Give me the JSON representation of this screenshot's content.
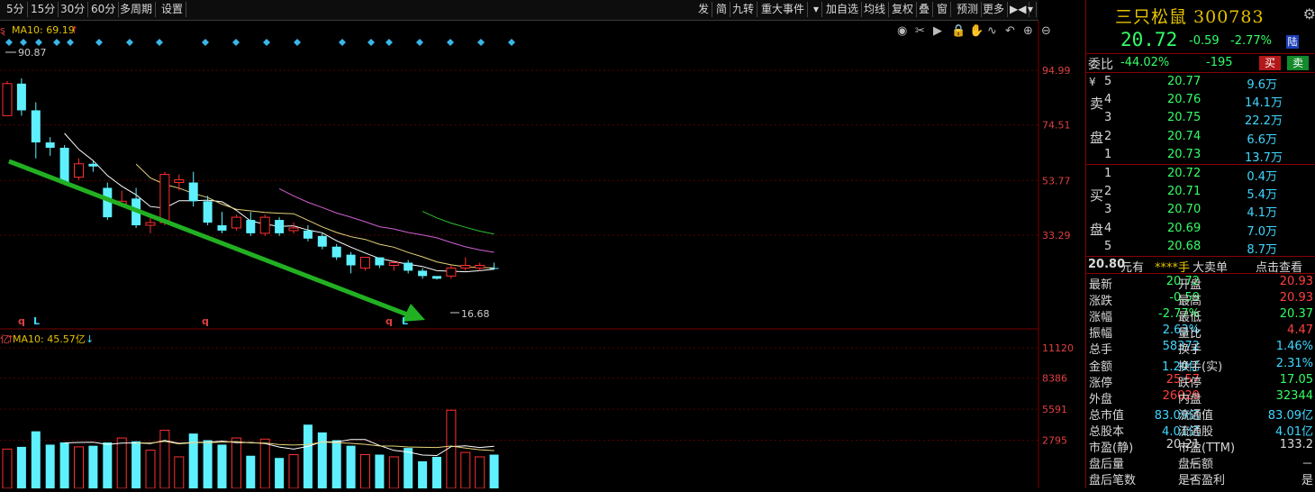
{
  "toolbar": {
    "periods": [
      "5分",
      "15分",
      "30分",
      "60分",
      "多周期",
      "设置"
    ],
    "right_tools": [
      "发",
      "简",
      "九转",
      "重大事件",
      "▾",
      "加自选",
      "均线",
      "复权",
      "叠",
      "窗",
      "预测",
      "更多",
      "▶◀",
      "▾"
    ]
  },
  "main_chart": {
    "ma_label": "MA10: 69.19",
    "marker_left": "ȿ",
    "annotations": {
      "high": "90.87",
      "low": "16.68"
    },
    "price_ticks": [
      "94.99",
      "74.51",
      "53.77",
      "33.29"
    ],
    "bottom_marks": [
      "q",
      "L",
      "q",
      "q",
      "L"
    ],
    "toolbar_icons": [
      "eye-icon",
      "scissors-icon",
      "play-icon",
      "lock-icon",
      "hand-icon",
      "wave-icon",
      "undo-icon",
      "zoom-in-icon",
      "zoom-out-icon"
    ]
  },
  "volume_chart": {
    "unit": "亿",
    "ma_label": "MA10: 45.57亿",
    "ticks": [
      "11120",
      "8386",
      "5591",
      "2795"
    ]
  },
  "chart_data": {
    "type": "candlestick",
    "price_axis": {
      "ticks": [
        94.99,
        74.51,
        53.77,
        33.29
      ]
    },
    "candles": [
      {
        "o": 78,
        "c": 90,
        "h": 91,
        "l": 78
      },
      {
        "o": 90,
        "c": 80,
        "h": 92,
        "l": 78
      },
      {
        "o": 80,
        "c": 68,
        "h": 83,
        "l": 62
      },
      {
        "o": 68,
        "c": 66,
        "h": 70,
        "l": 63
      },
      {
        "o": 66,
        "c": 53,
        "h": 67,
        "l": 52
      },
      {
        "o": 55,
        "c": 60,
        "h": 62,
        "l": 54
      },
      {
        "o": 60,
        "c": 59,
        "h": 61,
        "l": 57
      },
      {
        "o": 51,
        "c": 40,
        "h": 53,
        "l": 39
      },
      {
        "o": 45,
        "c": 46,
        "h": 50,
        "l": 44
      },
      {
        "o": 47,
        "c": 37,
        "h": 51,
        "l": 36
      },
      {
        "o": 37,
        "c": 38,
        "h": 40,
        "l": 34
      },
      {
        "o": 38,
        "c": 56,
        "h": 57,
        "l": 37
      },
      {
        "o": 53,
        "c": 54,
        "h": 56,
        "l": 50
      },
      {
        "o": 53,
        "c": 46,
        "h": 57,
        "l": 44
      },
      {
        "o": 46,
        "c": 38,
        "h": 48,
        "l": 37
      },
      {
        "o": 37,
        "c": 35,
        "h": 42,
        "l": 34
      },
      {
        "o": 36,
        "c": 40,
        "h": 41,
        "l": 35
      },
      {
        "o": 39,
        "c": 34,
        "h": 42,
        "l": 33
      },
      {
        "o": 34,
        "c": 40,
        "h": 41,
        "l": 33
      },
      {
        "o": 39,
        "c": 34,
        "h": 40,
        "l": 33
      },
      {
        "o": 35,
        "c": 36,
        "h": 38,
        "l": 34
      },
      {
        "o": 35,
        "c": 32,
        "h": 37,
        "l": 31
      },
      {
        "o": 33,
        "c": 29,
        "h": 34,
        "l": 28
      },
      {
        "o": 29,
        "c": 25,
        "h": 30,
        "l": 24
      },
      {
        "o": 26,
        "c": 22,
        "h": 27,
        "l": 19
      },
      {
        "o": 21,
        "c": 25,
        "h": 25,
        "l": 20
      },
      {
        "o": 25,
        "c": 22,
        "h": 25,
        "l": 21
      },
      {
        "o": 22,
        "c": 23,
        "h": 24,
        "l": 20
      },
      {
        "o": 23,
        "c": 20,
        "h": 24,
        "l": 19
      },
      {
        "o": 20,
        "c": 18,
        "h": 21,
        "l": 17
      },
      {
        "o": 18,
        "c": 17,
        "h": 18,
        "l": 16.68
      },
      {
        "o": 18,
        "c": 21,
        "h": 22,
        "l": 17
      },
      {
        "o": 21,
        "c": 22,
        "h": 25,
        "l": 20
      },
      {
        "o": 21,
        "c": 22,
        "h": 23,
        "l": 20
      },
      {
        "o": 21,
        "c": 20.72,
        "h": 23,
        "l": 20.37
      }
    ],
    "volumes": [
      2000,
      2200,
      3600,
      2400,
      2600,
      2200,
      2300,
      2600,
      3000,
      2700,
      1900,
      3700,
      1300,
      3400,
      2800,
      2400,
      3000,
      1400,
      2900,
      1200,
      1500,
      4200,
      3500,
      2800,
      2300,
      1500,
      1500,
      1300,
      2100,
      900,
      1300,
      5500,
      1700,
      1300,
      1500
    ],
    "vol_axis": {
      "ticks": [
        11120,
        8386,
        5591,
        2795
      ]
    }
  },
  "panel": {
    "title": "三只松鼠 300783",
    "price": "20.72",
    "change": "-0.59",
    "change_pct": "-2.77%",
    "badge": "陆",
    "weibi_label": "委比",
    "weibi_pct": "-44.02%",
    "weibi_num": "-195",
    "buy_btn": "买",
    "sell_btn": "卖",
    "sell_label": [
      "卖",
      "盘"
    ],
    "buy_label": [
      "买",
      "盘"
    ],
    "yen": "¥",
    "asks": [
      {
        "n": "5",
        "p": "20.77",
        "v": "9.6万"
      },
      {
        "n": "4",
        "p": "20.76",
        "v": "14.1万"
      },
      {
        "n": "3",
        "p": "20.75",
        "v": "22.2万"
      },
      {
        "n": "2",
        "p": "20.74",
        "v": "6.6万"
      },
      {
        "n": "1",
        "p": "20.73",
        "v": "13.7万"
      }
    ],
    "bids": [
      {
        "n": "1",
        "p": "20.72",
        "v": "0.4万"
      },
      {
        "n": "2",
        "p": "20.71",
        "v": "5.4万"
      },
      {
        "n": "3",
        "p": "20.70",
        "v": "4.1万"
      },
      {
        "n": "4",
        "p": "20.69",
        "v": "7.0万"
      },
      {
        "n": "5",
        "p": "20.68",
        "v": "8.7万"
      }
    ],
    "big_order": {
      "price": "20.80",
      "unit": "元有",
      "hands": "****手",
      "label": "大卖单",
      "link": "点击查看"
    },
    "stats": [
      [
        "最新",
        "20.72",
        "g",
        "开盘",
        "20.93",
        "r"
      ],
      [
        "涨跌",
        "-0.59",
        "g",
        "最高",
        "20.93",
        "r"
      ],
      [
        "涨幅",
        "-2.77%",
        "g",
        "最低",
        "20.37",
        "g"
      ],
      [
        "振幅",
        "2.63%",
        "c",
        "量比",
        "4.47",
        "r"
      ],
      [
        "总手",
        "58372",
        "c",
        "换手",
        "1.46%",
        "c"
      ],
      [
        "金额",
        "1.20亿",
        "c",
        "换手(实)",
        "2.31%",
        "c"
      ],
      [
        "涨停",
        "25.57",
        "r",
        "跌停",
        "17.05",
        "g"
      ],
      [
        "外盘",
        "26029",
        "r",
        "内盘",
        "32344",
        "g"
      ],
      [
        "总市值",
        "83.09亿",
        "c",
        "流通值",
        "83.09亿",
        "c"
      ],
      [
        "总股本",
        "4.01亿",
        "c",
        "流通股",
        "4.01亿",
        "c"
      ],
      [
        "市盈(静)",
        "20.21",
        "w",
        "市盈(TTM)",
        "133.2",
        "w"
      ],
      [
        "盘后量",
        "－",
        "w",
        "盘后额",
        "－",
        "w"
      ],
      [
        "盘后笔数",
        "－",
        "w",
        "是否盈利",
        "是",
        "w"
      ]
    ]
  }
}
